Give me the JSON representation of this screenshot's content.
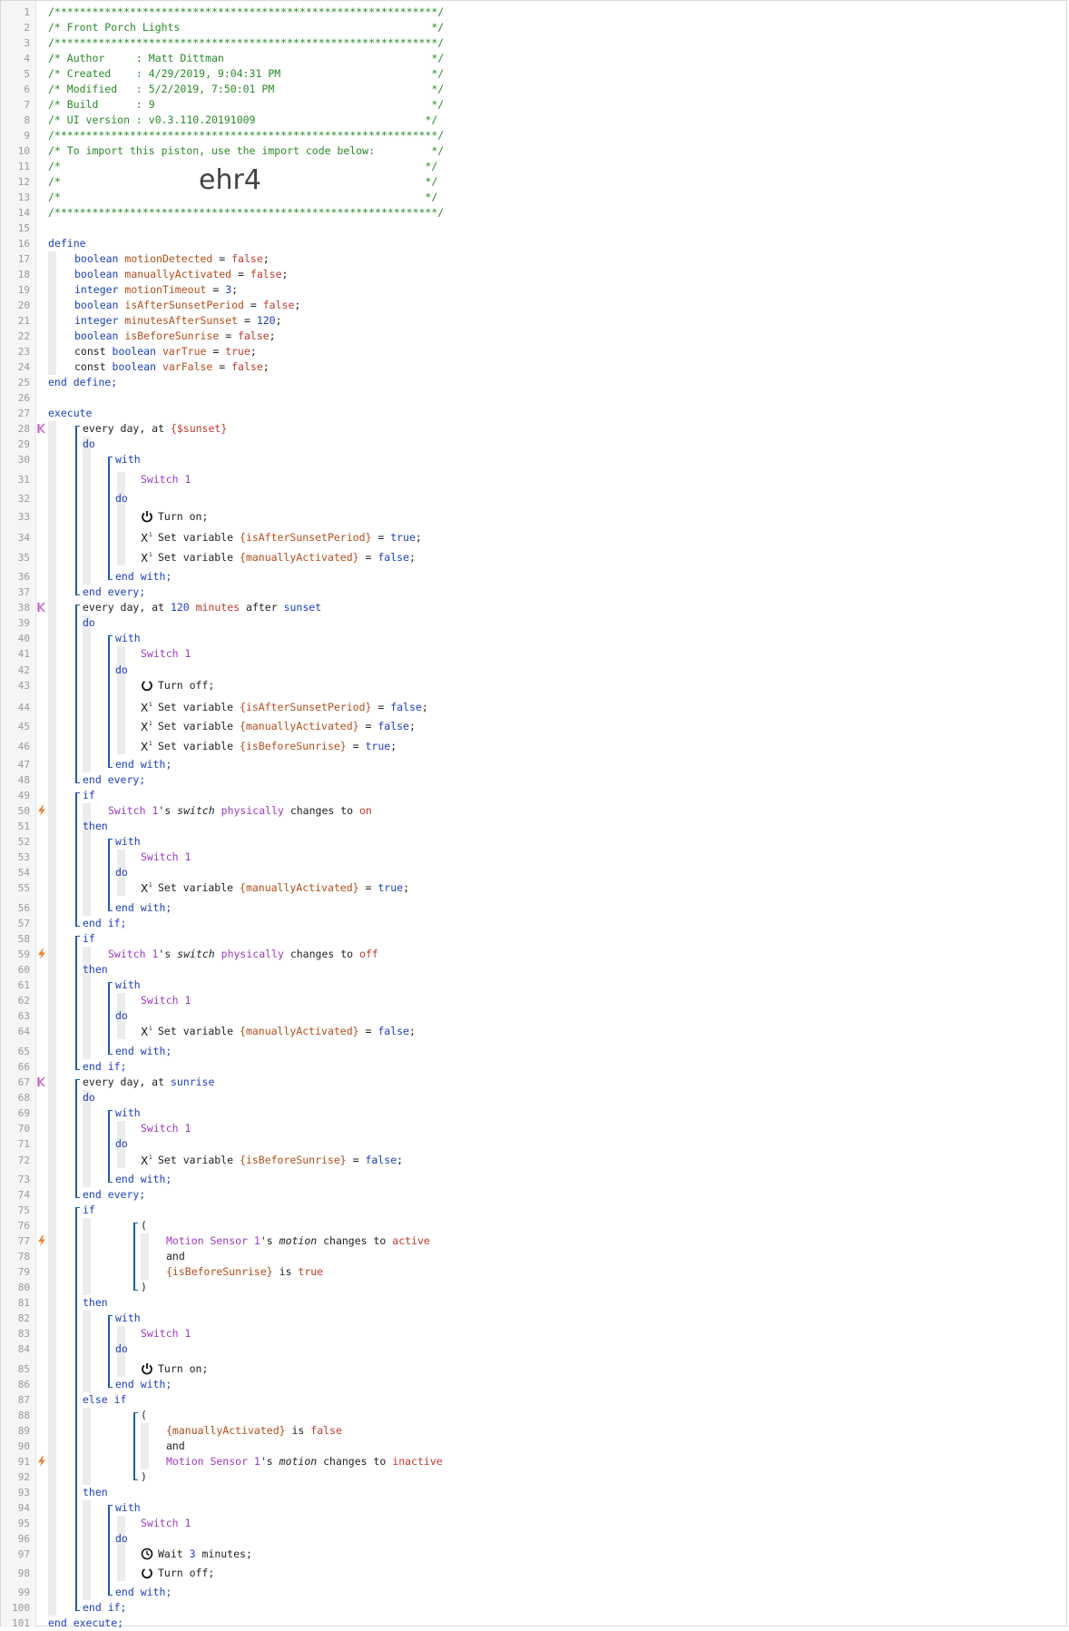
{
  "header": {
    "stars": "/*************************************************************/",
    "title_line": "/* Front Porch Lights                                        */",
    "author_line": "/* Author     : Matt Dittman                                 */",
    "created_line": "/* Created    : 4/29/2019, 9:04:31 PM                        */",
    "modified_line": "/* Modified   : 5/2/2019, 7:50:01 PM                         */",
    "build_line": "/* Build      : 9                                            */",
    "ui_line": "/* UI version : v0.3.110.20191009                           */",
    "import_line": "/* To import this piston, use the import code below:         */",
    "blank_line": "/*                                                          */",
    "import_code": "ehr4"
  },
  "line_numbers": [
    "1",
    "2",
    "3",
    "4",
    "5",
    "6",
    "7",
    "8",
    "9",
    "10",
    "11",
    "12",
    "13",
    "14",
    "15",
    "16",
    "17",
    "18",
    "19",
    "20",
    "21",
    "22",
    "23",
    "24",
    "25",
    "26",
    "27",
    "28",
    "29",
    "30",
    "31",
    "32",
    "33",
    "34",
    "35",
    "36",
    "37",
    "38",
    "39",
    "40",
    "41",
    "42",
    "43",
    "44",
    "45",
    "46",
    "47",
    "48",
    "49",
    "50",
    "51",
    "52",
    "53",
    "54",
    "55",
    "56",
    "57",
    "58",
    "59",
    "60",
    "61",
    "62",
    "63",
    "64",
    "65",
    "66",
    "67",
    "68",
    "69",
    "70",
    "71",
    "72",
    "73",
    "74",
    "75",
    "76",
    "77",
    "78",
    "79",
    "80",
    "81",
    "82",
    "83",
    "84",
    "85",
    "86",
    "87",
    "88",
    "89",
    "90",
    "91",
    "92",
    "93",
    "94",
    "95",
    "96",
    "97",
    "98",
    "99",
    "100",
    "101"
  ],
  "define": {
    "keyword": "define",
    "end": "end define;",
    "vars": [
      {
        "const": "",
        "type": "boolean",
        "name": "motionDetected",
        "value": "false"
      },
      {
        "const": "",
        "type": "boolean",
        "name": "manuallyActivated",
        "value": "false"
      },
      {
        "const": "",
        "type": "integer",
        "name": "motionTimeout",
        "value": "3"
      },
      {
        "const": "",
        "type": "boolean",
        "name": "isAfterSunsetPeriod",
        "value": "false"
      },
      {
        "const": "",
        "type": "integer",
        "name": "minutesAfterSunset",
        "value": "120"
      },
      {
        "const": "",
        "type": "boolean",
        "name": "isBeforeSunrise",
        "value": "false"
      },
      {
        "const": "const ",
        "type": "boolean",
        "name": "varTrue",
        "value": "true"
      },
      {
        "const": "const ",
        "type": "boolean",
        "name": "varFalse",
        "value": "false"
      }
    ]
  },
  "kw": {
    "execute": "execute",
    "end_execute": "end execute;",
    "every_day_at": "every day",
    "comma_at": ", at ",
    "do": "do",
    "with": "with",
    "end_with": "end with;",
    "end_every": "end every;",
    "if": "if",
    "then": "then",
    "end_if": "end if;",
    "else_if": "else if",
    "and": "and",
    "open_paren": "(",
    "close_paren": ")",
    "eq": " = ",
    "semi": ";",
    "turn_on": "Turn on;",
    "turn_off": "Turn off;",
    "set_variable": "Set variable ",
    "wait": "Wait ",
    "minutes_semi": " minutes;",
    "s_prefix": "'s ",
    "physically": "physically",
    "changes_to": " changes to ",
    "is": " is ",
    "after": " after ",
    "minutes": " minutes"
  },
  "values": {
    "sunset_expr": "{$sunset}",
    "sunset": "sunset",
    "sunrise": "sunrise",
    "offset": "120",
    "switch1": "Switch 1",
    "switch_dev": "Switch 1",
    "motion_dev": "Motion Sensor 1",
    "switch_attr": "switch",
    "motion_attr": "motion",
    "on": "on",
    "off": "off",
    "active": "active",
    "inactive": "inactive",
    "true": "true",
    "false": "false",
    "v_isAfterSunsetPeriod": "{isAfterSunsetPeriod}",
    "v_manuallyActivated": "{manuallyActivated}",
    "v_isBeforeSunrise": "{isBeforeSunrise}",
    "wait_minutes": "3"
  },
  "colors": {
    "comment": "#2a8a2a",
    "keyword": "#1c3fbf",
    "variable": "#b34d1a",
    "value": "#c0392b",
    "device": "#9b3bbf",
    "bracket": "#1f5ea8",
    "trigger_icon": "#e8863a",
    "timer_icon": "#c24fc2"
  },
  "icons": {
    "power": "power-icon",
    "power_off": "power-off-icon",
    "variable": "variable-icon",
    "clock": "clock-icon",
    "trigger": "lightning-trigger-icon",
    "timer": "timer-trigger-icon"
  }
}
